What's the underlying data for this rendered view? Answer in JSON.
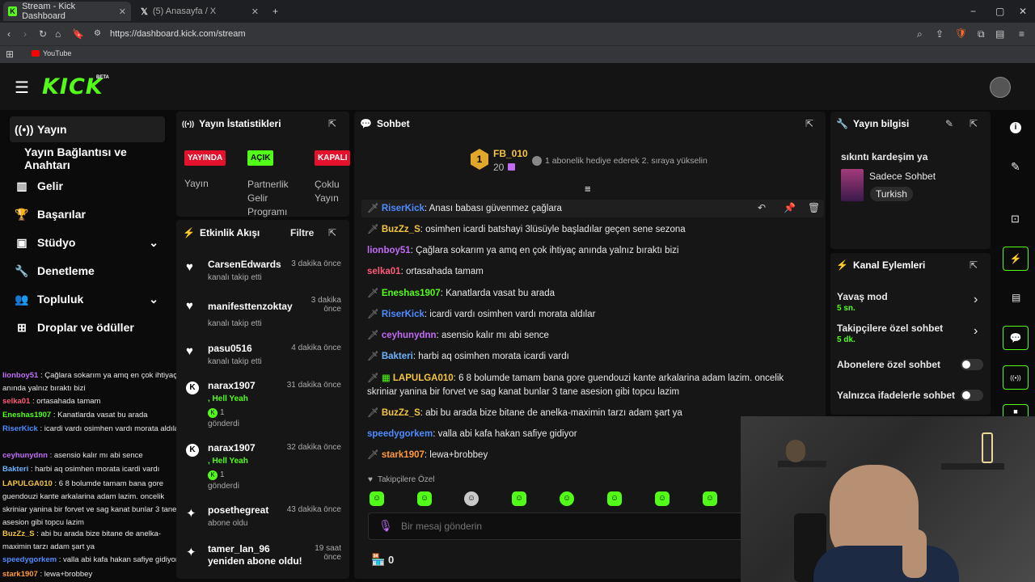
{
  "browser": {
    "tabs": [
      {
        "title": "Stream - Kick Dashboard"
      },
      {
        "title": "(5) Anasayfa / X"
      }
    ],
    "url": "https://dashboard.kick.com/stream",
    "bookmark": "YouTube"
  },
  "app": {
    "logo": "KICK",
    "beta": "BETA"
  },
  "sidebar": {
    "items": [
      {
        "label": "Yayın",
        "icon": "broadcast-icon"
      },
      {
        "label": "Yayın Bağlantısı ve Anahtarı",
        "icon": ""
      },
      {
        "label": "Gelir",
        "icon": "chart-icon"
      },
      {
        "label": "Başarılar",
        "icon": "trophy-icon"
      },
      {
        "label": "Stüdyo",
        "icon": "studio-icon"
      },
      {
        "label": "Denetleme",
        "icon": "wrench-icon"
      },
      {
        "label": "Topluluk",
        "icon": "people-icon"
      },
      {
        "label": "Droplar ve ödüller",
        "icon": "gift-icon"
      }
    ]
  },
  "stats": {
    "title": "Yayın İstatistikleri",
    "badges": [
      {
        "state": "YAYINDA",
        "label": "Yayın",
        "color": "#e3112b"
      },
      {
        "state": "AÇIK",
        "label": "Partnerlik Gelir Programı",
        "color": "#53fc18"
      },
      {
        "state": "KAPALI",
        "label": "Çoklu Yayın",
        "color": "#e3112b"
      }
    ]
  },
  "activity": {
    "title": "Etkinlik Akışı",
    "filter": "Filtre",
    "events": [
      {
        "name": "CarsenEdwards",
        "time": "3 dakika önce",
        "sub": "kanalı takip etti",
        "icon": "heart-icon"
      },
      {
        "name": "manifesttenzoktay",
        "time": "3 dakika önce",
        "sub": "kanalı takip etti",
        "icon": "heart-icon"
      },
      {
        "name": "pasu0516",
        "time": "4 dakika önce",
        "sub": "kanalı takip etti",
        "icon": "heart-icon"
      },
      {
        "name": "narax1907",
        "time": "31 dakika önce",
        "sub": ", Hell Yeah",
        "count": "1",
        "sent": "gönderdi",
        "icon": "kick-icon"
      },
      {
        "name": "narax1907",
        "time": "32 dakika önce",
        "sub": ", Hell Yeah",
        "count": "1",
        "sent": "gönderdi",
        "icon": "kick-icon"
      },
      {
        "name": "posethegreat",
        "time": "43 dakika önce",
        "sub": "abone oldu",
        "icon": "sparkle-icon"
      },
      {
        "name": "tamer_lan_96 yeniden abone oldu!",
        "time": "19 saat önce",
        "sub": "",
        "icon": "sparkle-icon"
      }
    ]
  },
  "chat": {
    "title": "Sohbet",
    "pinned_user": "FB_010",
    "pinned_count": "20",
    "rank_number": "1",
    "gift_text": "1 abonelik hediye ederek 2. sıraya yükselin",
    "messages": [
      {
        "user": "RiserKick",
        "color": "#4d8cff",
        "text": "Anası babası güvenmez çağlara"
      },
      {
        "user": "BuzZz_S",
        "color": "#f5c542",
        "text": "osimhen icardi batshayi 3lüsüyle başladılar geçen sene sezona"
      },
      {
        "user": "lionboy51",
        "color": "#c06cf5",
        "text": "Çağlara sokarım ya amq en çok ihtiyaç anında yalnız bıraktı bizi"
      },
      {
        "user": "selka01",
        "color": "#ff5a7a",
        "text": "ortasahada tamam"
      },
      {
        "user": "Eneshas1907",
        "color": "#53fc18",
        "text": "Kanatlarda vasat bu arada"
      },
      {
        "user": "RiserKick",
        "color": "#4d8cff",
        "text": "icardi vardı osimhen vardı morata aldılar"
      },
      {
        "user": "ceyhunydnn",
        "color": "#c06cf5",
        "text": "asensio kalır mı abi sence"
      },
      {
        "user": "Bakteri",
        "color": "#6ab4ff",
        "text": "harbi aq osimhen morata icardi vardı"
      },
      {
        "user": "LAPULGA010",
        "color": "#f5c542",
        "text": "6 8 bolumde tamam bana gore guendouzi kante arkalarina adam lazim. oncelik skriniar yanina bir forvet ve sag kanat bunlar 3 tane asesion gibi topcu lazim"
      },
      {
        "user": "BuzZz_S",
        "color": "#f5c542",
        "text": "abi bu arada bize bitane de anelka-maximin tarzı adam şart ya"
      },
      {
        "user": "speedygorkem",
        "color": "#4d8cff",
        "text": "valla abi kafa hakan safiye gidiyor"
      },
      {
        "user": "stark1907",
        "color": "#ff9a3c",
        "text": "lewa+brobbey"
      }
    ],
    "followers_only": "Takipçilere Özel",
    "input_placeholder": "Bir mesaj gönderin",
    "points": "0"
  },
  "left_chat": [
    {
      "user": "lionboy51",
      "color": "#c06cf5",
      "text": "Çağlara sokarım ya amq en çok ihtiyaç anında yalnız bıraktı bizi"
    },
    {
      "user": "selka01",
      "color": "#ff5a7a",
      "text": "ortasahada tamam"
    },
    {
      "user": "Eneshas1907",
      "color": "#53fc18",
      "text": "Kanatlarda vasat bu arada"
    },
    {
      "user": "RiserKick",
      "color": "#4d8cff",
      "text": "icardi vardı osimhen vardı morata aldılar"
    },
    {
      "user": "ceyhunydnn",
      "color": "#c06cf5",
      "text": "asensio kalır mı abi sence"
    },
    {
      "user": "Bakteri",
      "color": "#6ab4ff",
      "text": "harbi aq osimhen morata icardi vardı"
    },
    {
      "user": "LAPULGA010",
      "color": "#f5c542",
      "text": "6 8 bolumde tamam bana gore guendouzi kante arkalarina adam lazim. oncelik skriniar yanina bir forvet ve sag kanat bunlar 3 tane asesion gibi topcu lazim"
    },
    {
      "user": "BuzZz_S",
      "color": "#f5c542",
      "text": "abi bu arada bize bitane de anelka-maximin tarzı adam şart ya"
    },
    {
      "user": "speedygorkem",
      "color": "#4d8cff",
      "text": "valla abi kafa hakan safiye gidiyor"
    },
    {
      "user": "stark1907",
      "color": "#ff9a3c",
      "text": "lewa+brobbey"
    }
  ],
  "info": {
    "title": "Yayın bilgisi",
    "stream_title": "sıkıntı kardeşim ya",
    "category": "Sadece Sohbet",
    "language": "Turkish"
  },
  "actions": {
    "title": "Kanal Eylemleri",
    "slow_mode": "Yavaş mod",
    "slow_value": "5 sn.",
    "followers_chat": "Takipçilere özel sohbet",
    "followers_value": "5 dk.",
    "subs_chat": "Abonelere özel sohbet",
    "emote_chat": "Yalnızca ifadelerle sohbet"
  }
}
